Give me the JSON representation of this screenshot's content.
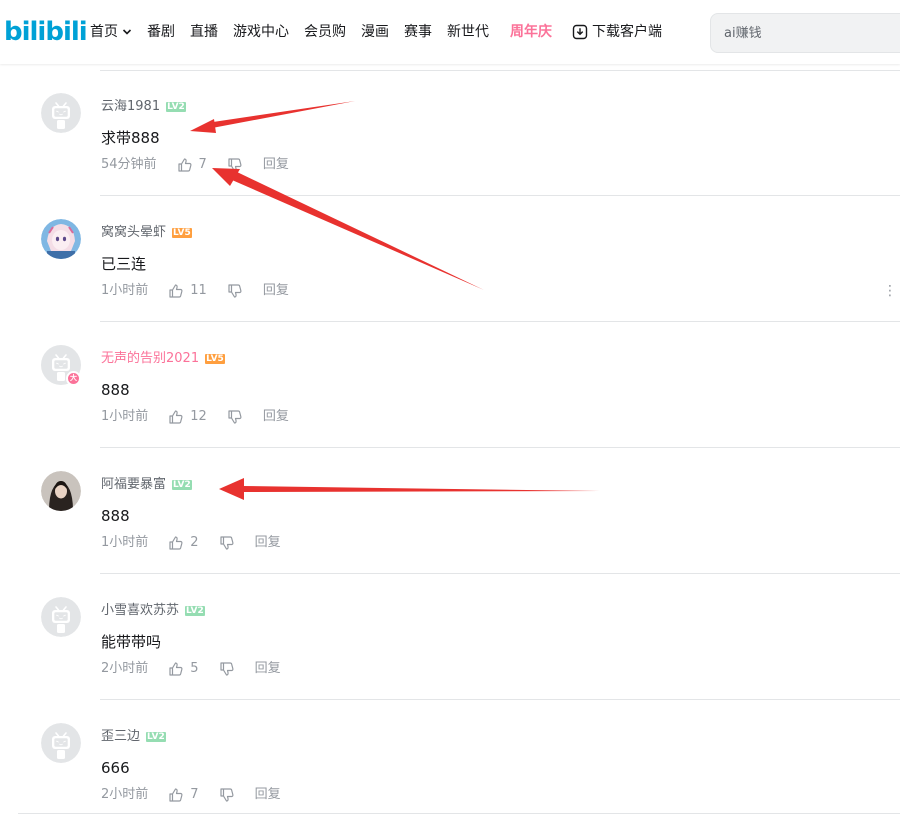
{
  "header": {
    "logo_text": "bilibili",
    "nav": [
      {
        "label": "首页",
        "name": "nav-home"
      },
      {
        "label": "番剧",
        "name": "nav-anime"
      },
      {
        "label": "直播",
        "name": "nav-live"
      },
      {
        "label": "游戏中心",
        "name": "nav-game-center"
      },
      {
        "label": "会员购",
        "name": "nav-member-shop"
      },
      {
        "label": "漫画",
        "name": "nav-manga"
      },
      {
        "label": "赛事",
        "name": "nav-esports"
      },
      {
        "label": "新世代",
        "name": "nav-new-generation"
      }
    ],
    "anniversary_label": "周年庆",
    "download_label": "下载客户端",
    "search_placeholder": "ai赚钱"
  },
  "comments": [
    {
      "user": "云海1981",
      "level": "LV2",
      "text": "求带888",
      "time": "54分钟前",
      "likes": "7",
      "reply": "回复"
    },
    {
      "user": "窝窝头晕虾",
      "level": "LV5",
      "text": "已三连",
      "time": "1小时前",
      "likes": "11",
      "reply": "回复"
    },
    {
      "user": "无声的告别2021",
      "level": "LV5",
      "text": "888",
      "time": "1小时前",
      "likes": "12",
      "reply": "回复",
      "badge": "大"
    },
    {
      "user": "阿福要暴富",
      "level": "LV2",
      "text": "888",
      "time": "1小时前",
      "likes": "2",
      "reply": "回复"
    },
    {
      "user": "小雪喜欢苏苏",
      "level": "LV2",
      "text": "能带带吗",
      "time": "2小时前",
      "likes": "5",
      "reply": "回复"
    },
    {
      "user": "歪三边",
      "level": "LV2",
      "text": "666",
      "time": "2小时前",
      "likes": "7",
      "reply": "回复"
    }
  ],
  "colors": {
    "brand": "#00a1d6",
    "anniversary": "#fb7299",
    "vip_name": "#fb7299",
    "level_green": "#95ddb2",
    "level_orange": "#ff9f3f",
    "annotation_arrow": "#e8322f"
  },
  "icons": [
    "chevron-down-icon",
    "download-icon",
    "thumbs-up-icon",
    "thumbs-down-icon",
    "more-icon",
    "default-avatar-icon"
  ]
}
